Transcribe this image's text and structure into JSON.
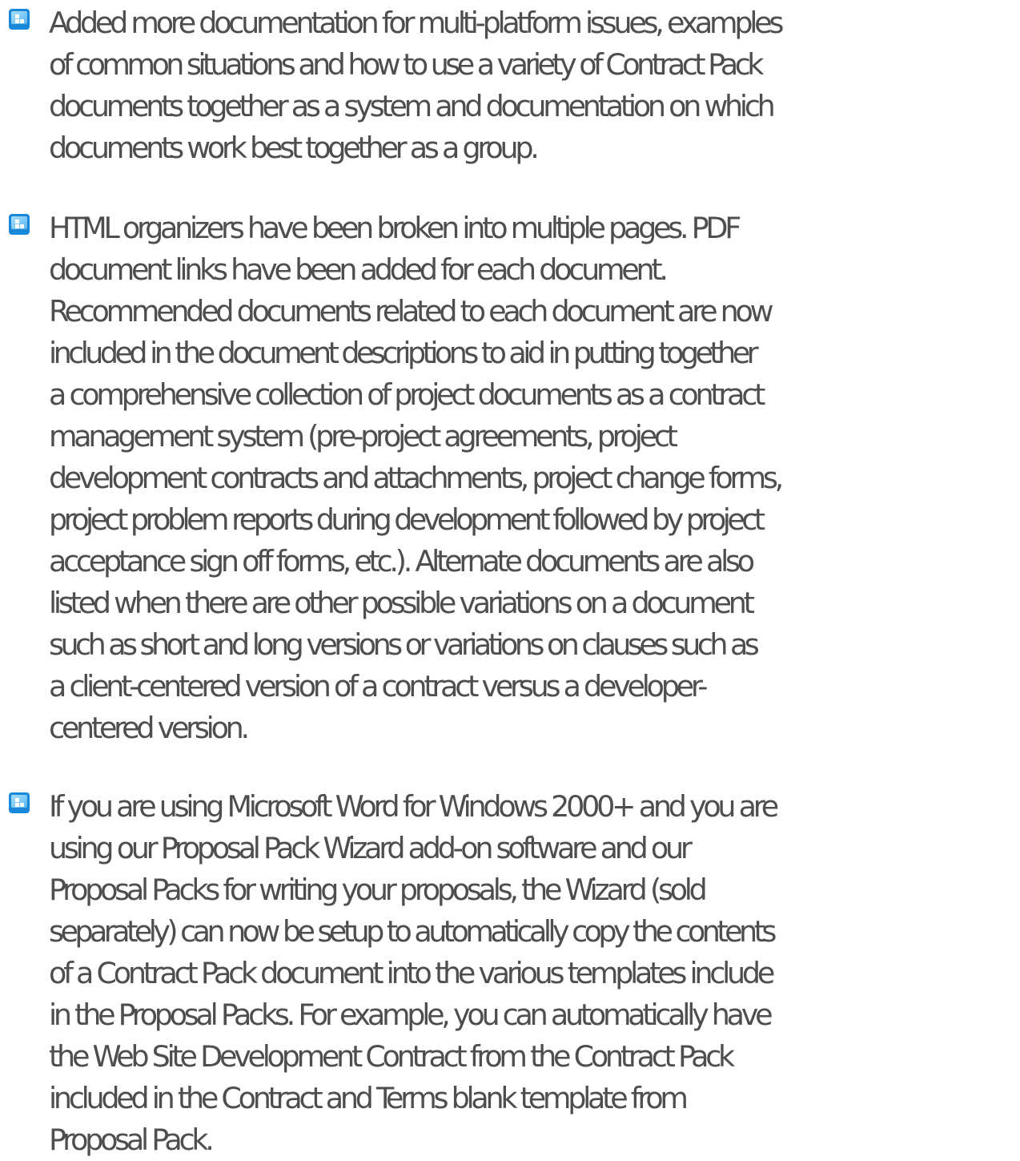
{
  "bullet_icon": "blue-square-bullet-icon",
  "colors": {
    "text": "#4e4e4e",
    "bullet_dark": "#1a88d8",
    "bullet_light": "#8ed2fb"
  },
  "features": [
    {
      "lines": [
        "Added more documentation for multi-platform issues, examples",
        "of common situations and how to use a variety of Contract Pack",
        "documents together as a system and documentation on which",
        "documents work best together as a group."
      ]
    },
    {
      "lines": [
        "HTML organizers have been broken into multiple pages. PDF",
        "document links have been added for each document.",
        "Recommended documents related to each document are now",
        "included in the document descriptions to aid in putting together",
        "a comprehensive collection of project documents as a contract",
        "management system (pre-project agreements, project",
        "development contracts and attachments, project change forms,",
        "project problem reports during development followed by project",
        "acceptance sign off forms, etc.). Alternate documents are also",
        "listed when there are other possible variations on a document",
        "such as short and long versions or variations on clauses such as",
        "a client-centered version of a contract versus a developer-",
        "centered version."
      ]
    },
    {
      "lines": [
        "If you are using Microsoft Word for Windows 2000+ and you are",
        "using our Proposal Pack Wizard add-on software and our",
        "Proposal Packs for writing your proposals, the Wizard (sold",
        "separately) can now be setup to automatically copy the contents",
        "of a Contract Pack document into the various templates include",
        "in the Proposal Packs. For example, you can automatically have",
        "the Web Site Development Contract from the Contract Pack",
        "included in the Contract and Terms blank template from",
        "Proposal Pack."
      ]
    }
  ]
}
